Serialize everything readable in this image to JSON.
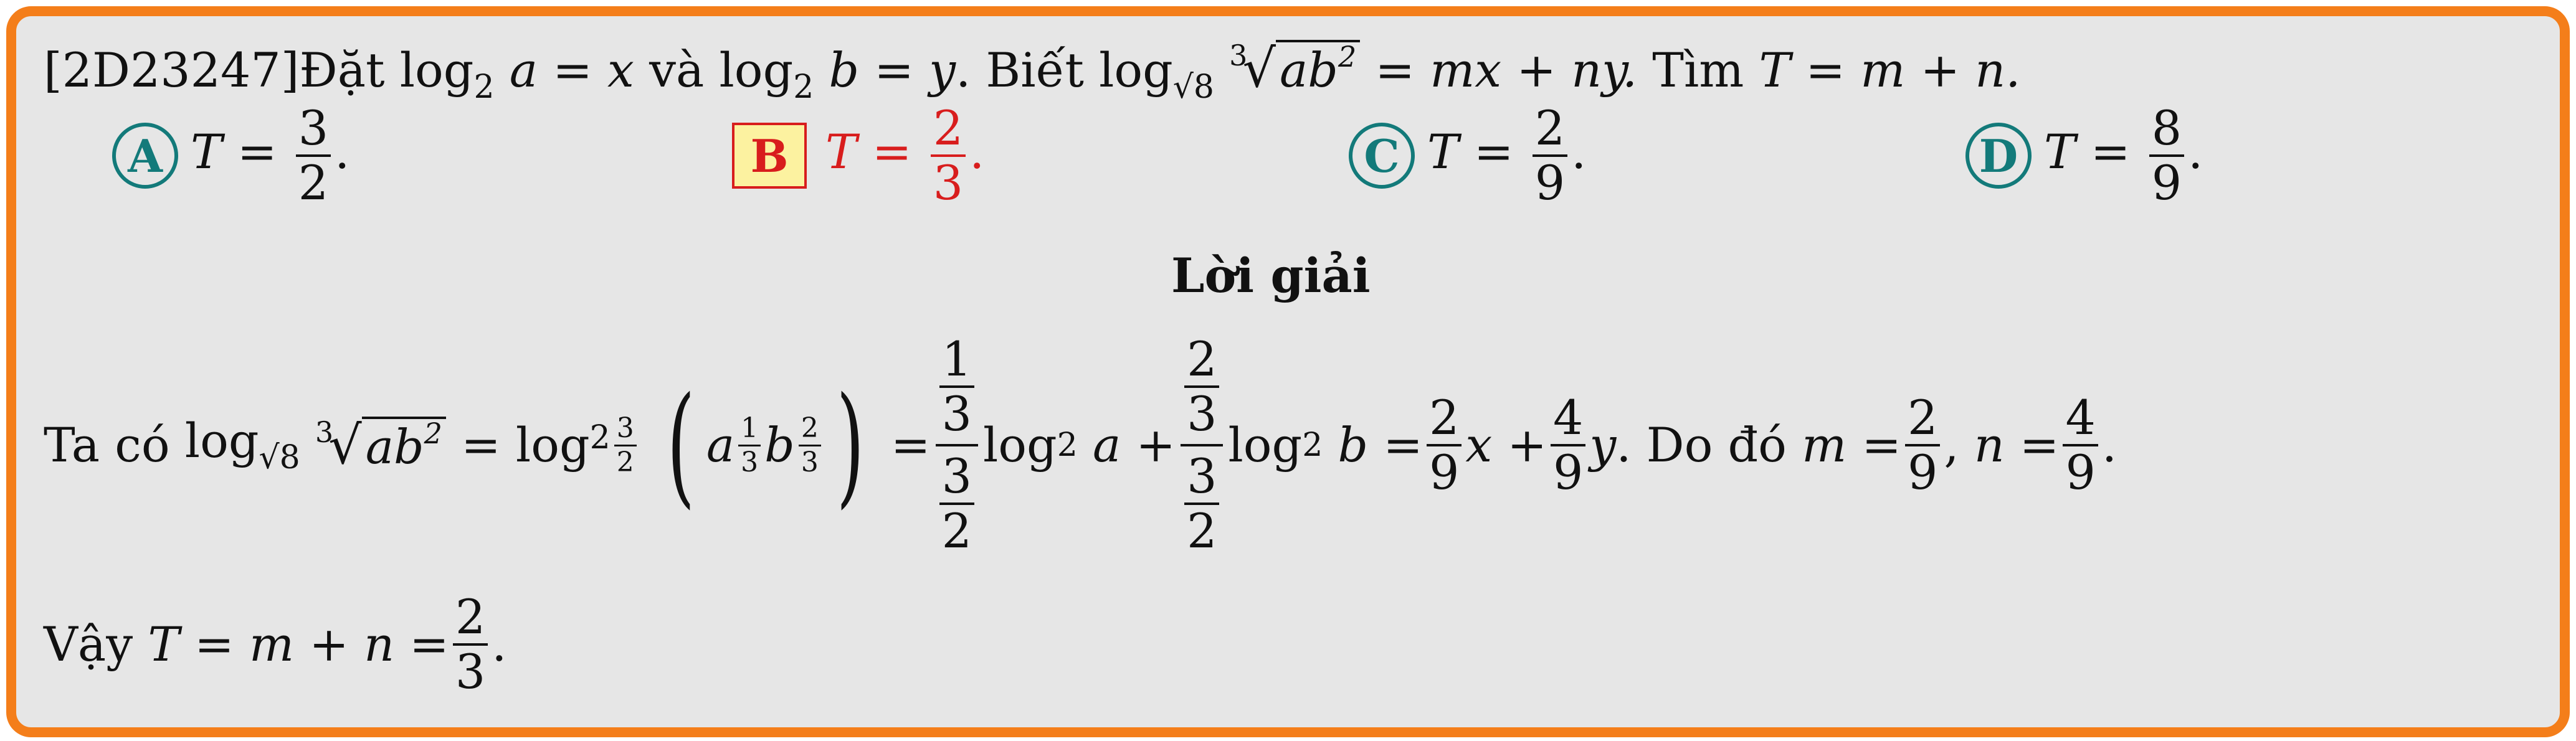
{
  "question": {
    "id": "[2D23247]",
    "lead": "Đặt",
    "and": "và",
    "known": "Biết",
    "find": "Tìm",
    "log": "log",
    "sub2": "2",
    "a": "a",
    "b": "b",
    "x": "x",
    "y": "y",
    "eq_tail": "= mx + ny.",
    "find_expr": "T = m + n."
  },
  "options": [
    {
      "letter": "A",
      "lhs": "T =",
      "num": "3",
      "den": "2",
      "correct": false
    },
    {
      "letter": "B",
      "lhs": "T =",
      "num": "2",
      "den": "3",
      "correct": true
    },
    {
      "letter": "C",
      "lhs": "T =",
      "num": "2",
      "den": "9",
      "correct": false
    },
    {
      "letter": "D",
      "lhs": "T =",
      "num": "8",
      "den": "9",
      "correct": false
    }
  ],
  "solution": {
    "heading": "Lời giải",
    "intro": "Ta có",
    "then": "Do đó",
    "m_expr": "m =",
    "n_expr": "n =",
    "m_num": "2",
    "m_den": "9",
    "n_num": "4",
    "n_den": "9",
    "conclusion_lead": "Vậy",
    "conclusion_expr": "T = m + n =",
    "final_num": "2",
    "final_den": "3"
  },
  "colors": {
    "border": "#f47e1a",
    "background": "#e6e6e6",
    "option_circle": "#137a7a",
    "correct": "#d81d1d",
    "correct_fill": "#fcf2a0"
  }
}
